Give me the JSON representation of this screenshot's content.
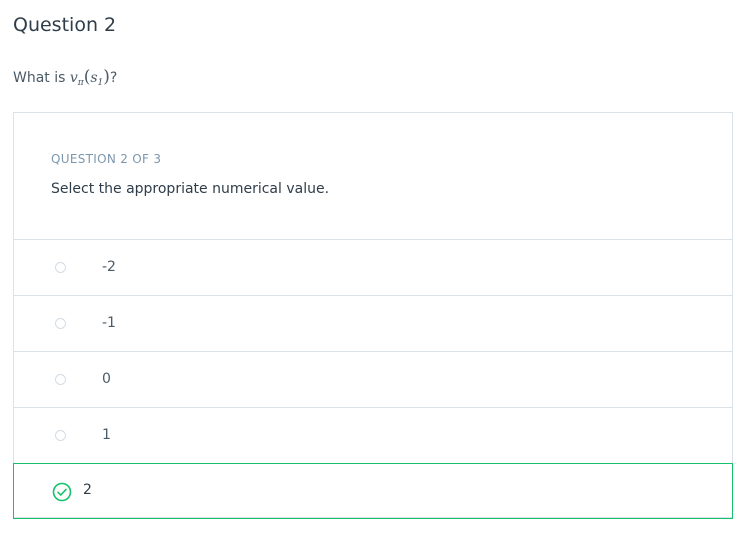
{
  "question": {
    "heading": "Question 2",
    "prompt_prefix": "What is ",
    "prompt_math": {
      "v": "v",
      "sub": "π",
      "arg": "s",
      "arg_sub": "1"
    },
    "prompt_suffix": "?"
  },
  "quiz": {
    "counter": "QUESTION 2 OF 3",
    "instruction": "Select the appropriate numerical value.",
    "options": [
      {
        "label": "-2",
        "selected": false
      },
      {
        "label": "-1",
        "selected": false
      },
      {
        "label": "0",
        "selected": false
      },
      {
        "label": "1",
        "selected": false
      },
      {
        "label": "2",
        "selected": true
      }
    ]
  },
  "colors": {
    "correct": "#15c26b",
    "border": "#dbe2e8",
    "counter": "#7d97ad"
  },
  "icons": {
    "radio": "radio-empty-icon",
    "selected": "check-circle-icon"
  }
}
